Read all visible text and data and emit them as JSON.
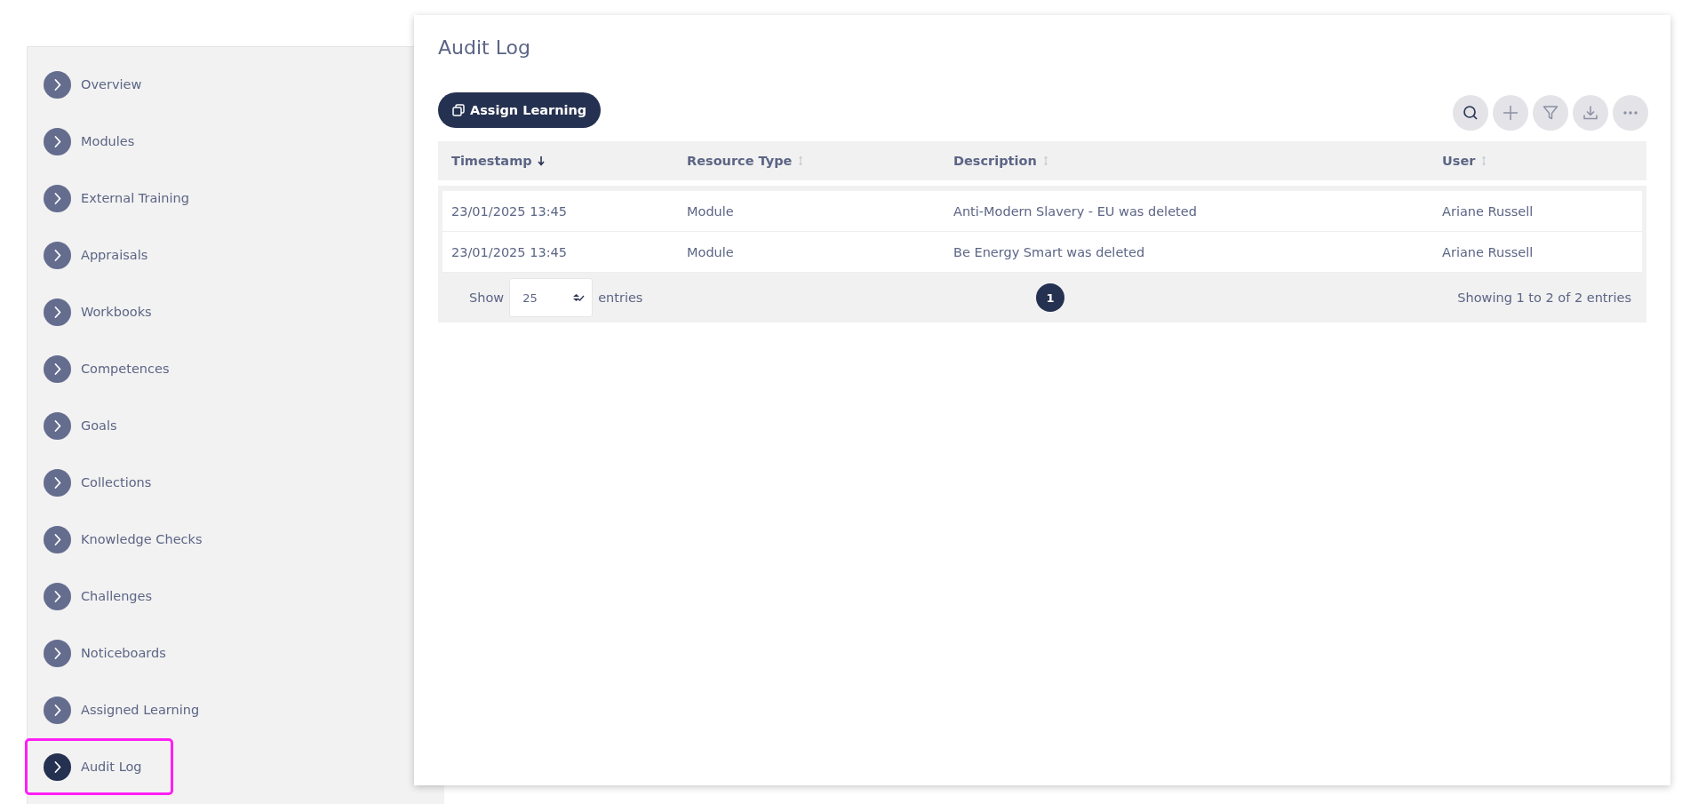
{
  "sidebar": {
    "items": [
      {
        "label": "Overview",
        "selected": false
      },
      {
        "label": "Modules",
        "selected": false
      },
      {
        "label": "External Training",
        "selected": false
      },
      {
        "label": "Appraisals",
        "selected": false
      },
      {
        "label": "Workbooks",
        "selected": false
      },
      {
        "label": "Competences",
        "selected": false
      },
      {
        "label": "Goals",
        "selected": false
      },
      {
        "label": "Collections",
        "selected": false
      },
      {
        "label": "Knowledge Checks",
        "selected": false
      },
      {
        "label": "Challenges",
        "selected": false
      },
      {
        "label": "Noticeboards",
        "selected": false
      },
      {
        "label": "Assigned Learning",
        "selected": false
      },
      {
        "label": "Audit Log",
        "selected": true
      }
    ]
  },
  "page": {
    "title": "Audit Log"
  },
  "toolbar": {
    "primary_button": "Assign Learning",
    "icon_buttons": [
      {
        "kind": "search"
      },
      {
        "kind": "add"
      },
      {
        "kind": "filter"
      },
      {
        "kind": "download"
      },
      {
        "kind": "more"
      }
    ]
  },
  "table": {
    "columns": [
      {
        "label": "Timestamp",
        "sorted": true
      },
      {
        "label": "Resource Type",
        "sorted": false
      },
      {
        "label": "Description",
        "sorted": false
      },
      {
        "label": "User",
        "sorted": false
      }
    ],
    "rows": [
      [
        "23/01/2025 13:45",
        "Module",
        "Anti-Modern Slavery - EU was deleted",
        "Ariane Russell"
      ],
      [
        "23/01/2025 13:45",
        "Module",
        "Be Energy Smart was deleted",
        "Ariane Russell"
      ]
    ]
  },
  "footer": {
    "show_label": "Show",
    "page_size": "25",
    "entries_label": "entries",
    "pages": [
      {
        "label": "1",
        "selected": true
      }
    ],
    "summary": "Showing 1 to 2 of 2 entries"
  }
}
